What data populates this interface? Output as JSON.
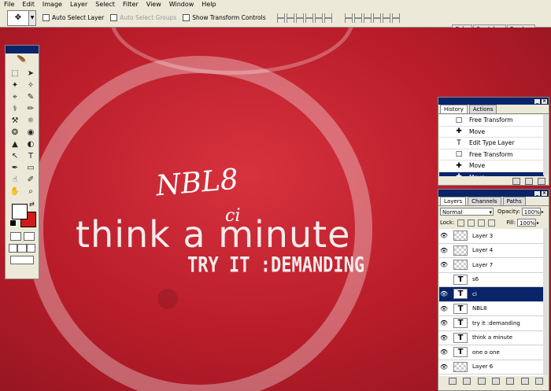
{
  "menu": [
    "File",
    "Edit",
    "Image",
    "Layer",
    "Select",
    "Filter",
    "View",
    "Window",
    "Help"
  ],
  "options_bar": {
    "tool_icon": "move-tool-icon",
    "checks": [
      {
        "label": "Auto Select Layer",
        "disabled": false
      },
      {
        "label": "Auto Select Groups",
        "disabled": true
      },
      {
        "label": "Show Transform Controls",
        "disabled": false
      }
    ],
    "well_tabs": [
      "Color",
      "Swatches",
      "Brushes"
    ]
  },
  "canvas": {
    "headline": "think a minute",
    "subline": "TRY IT :DEMANDING",
    "signature_main": "NBL8",
    "signature_sub": "ci"
  },
  "toolbox": {
    "tools": [
      "⬚",
      "➤",
      "✦",
      "✧",
      "⌖",
      "✎",
      "⚕",
      "✏",
      "⚒",
      "⚛",
      "❂",
      "◉",
      "▲",
      "◐",
      "↖",
      "T",
      "✒",
      "▭",
      "☝",
      "✐",
      "✋",
      "⌕"
    ],
    "fg_color": "#ffffff",
    "bg_color": "#d11a1a"
  },
  "history": {
    "tabs": [
      "History",
      "Actions"
    ],
    "items": [
      {
        "icon": "□",
        "label": "Free Transform",
        "selected": false
      },
      {
        "icon": "✚",
        "label": "Move",
        "selected": false
      },
      {
        "icon": "T",
        "label": "Edit Type Layer",
        "selected": false
      },
      {
        "icon": "□",
        "label": "Free Transform",
        "selected": false
      },
      {
        "icon": "✚",
        "label": "Move",
        "selected": false
      },
      {
        "icon": "✚",
        "label": "Move",
        "selected": true
      }
    ]
  },
  "layers": {
    "tabs": [
      "Layers",
      "Channels",
      "Paths"
    ],
    "blend_mode": "Normal",
    "opacity_label": "Opacity:",
    "opacity_value": "100%",
    "lock_label": "Lock:",
    "fill_label": "Fill:",
    "fill_value": "100%",
    "items": [
      {
        "name": "Layer 3",
        "type": "pixel",
        "visible": true,
        "selected": false
      },
      {
        "name": "Layer 4",
        "type": "pixel",
        "visible": true,
        "selected": false
      },
      {
        "name": "Layer 7",
        "type": "pixel",
        "visible": true,
        "selected": false
      },
      {
        "name": "s6",
        "type": "text",
        "visible": false,
        "selected": false
      },
      {
        "name": "ci",
        "type": "text",
        "visible": true,
        "selected": true
      },
      {
        "name": "NBL8",
        "type": "text",
        "visible": true,
        "selected": false
      },
      {
        "name": "try it :demanding",
        "type": "text",
        "visible": true,
        "selected": false
      },
      {
        "name": "think a minute",
        "type": "text",
        "visible": true,
        "selected": false
      },
      {
        "name": "one o one",
        "type": "text",
        "visible": true,
        "selected": false
      },
      {
        "name": "Layer 6",
        "type": "pixel",
        "visible": true,
        "selected": false
      }
    ]
  }
}
